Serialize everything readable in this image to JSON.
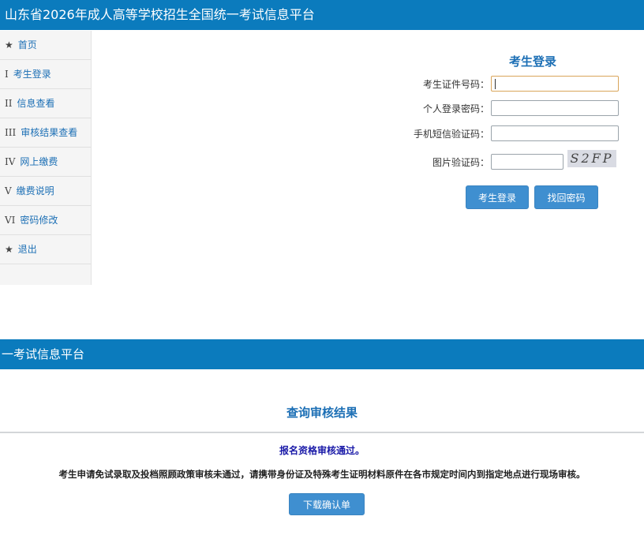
{
  "header": {
    "title": "山东省2026年成人高等学校招生全国统一考试信息平台"
  },
  "sidebar": {
    "items": [
      {
        "marker": "★",
        "label": "首页"
      },
      {
        "marker": "I",
        "label": "考生登录"
      },
      {
        "marker": "II",
        "label": "信息查看"
      },
      {
        "marker": "III",
        "label": "审核结果查看"
      },
      {
        "marker": "IV",
        "label": "网上缴费"
      },
      {
        "marker": "V",
        "label": "缴费说明"
      },
      {
        "marker": "VI",
        "label": "密码修改"
      },
      {
        "marker": "★",
        "label": "退出"
      }
    ]
  },
  "login": {
    "title": "考生登录",
    "fields": {
      "id_label": "考生证件号码：",
      "id_value": "",
      "password_label": "个人登录密码：",
      "password_value": "",
      "sms_label": "手机短信验证码：",
      "sms_value": "",
      "captcha_label": "图片验证码：",
      "captcha_value": ""
    },
    "captcha_text": "S2FP",
    "login_button": "考生登录",
    "recover_button": "找回密码"
  },
  "second_header": {
    "title": "一考试信息平台"
  },
  "result": {
    "title": "查询审核结果",
    "pass_message": "报名资格审核通过。",
    "notice": "考生申请免试录取及投档照顾政策审核未通过，请携带身份证及特殊考生证明材料原件在各市规定时间内到指定地点进行现场审核。",
    "download_button": "下载确认单"
  },
  "colors": {
    "header_bg": "#0b7bbd",
    "accent_text": "#1c6fb5",
    "button_bg": "#3f8fd0",
    "pass_text": "#1a1aa8",
    "focused_border": "#d9a55a"
  }
}
